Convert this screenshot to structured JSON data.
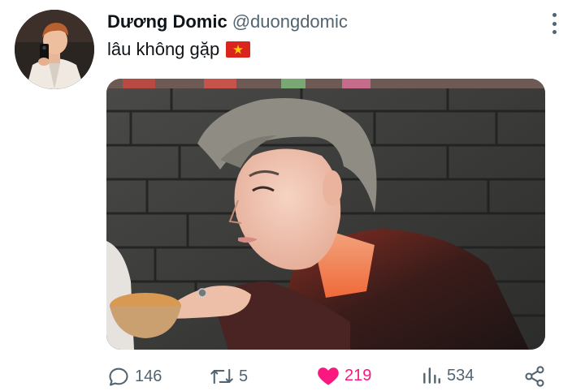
{
  "tweet": {
    "display_name": "Dương Domic",
    "handle": "@duongdomic",
    "text": "lâu không gặp",
    "flag_icon": "vietnam-flag-icon"
  },
  "actions": {
    "replies": "146",
    "retweets": "5",
    "likes": "219",
    "views": "534"
  },
  "colors": {
    "like_active": "#f91880",
    "icon_gray": "#536471",
    "text": "#0f1419"
  }
}
